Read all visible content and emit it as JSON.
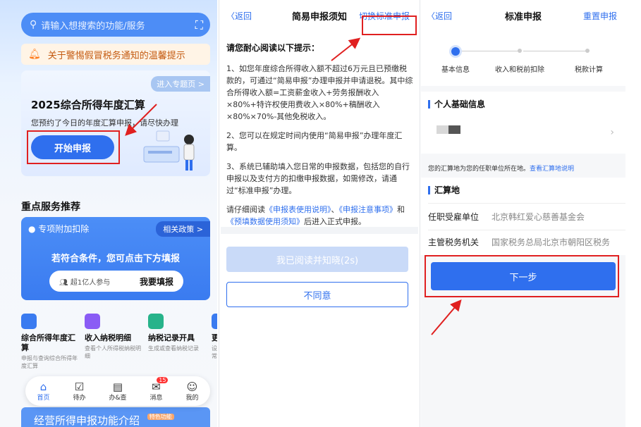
{
  "panel1": {
    "search_placeholder": "请输入想搜索的功能/服务",
    "notice": "关于警惕假冒税务通知的温馨提示",
    "hero": {
      "enter": "进入专题页 >",
      "title": "2025综合所得年度汇算",
      "subtitle": "您预约了今日的年度汇算申报，请尽快办理",
      "start_button": "开始申报"
    },
    "section_title": "重点服务推荐",
    "special": {
      "header": "专项附加扣除",
      "policy": "相关政策 >",
      "message": "若符合条件，您可点击下方填报",
      "participants": "超1亿人参与",
      "fill_button": "我要填报"
    },
    "services": [
      {
        "title": "综合所得年度汇算",
        "desc": "申报与查询综合所得年度汇算",
        "color": "#3a7bf0"
      },
      {
        "title": "收入纳税明细",
        "desc": "查看个人所得税纳税明细",
        "color": "#8a5cf5"
      },
      {
        "title": "纳税记录开具",
        "desc": "生成或查看纳税记录",
        "color": "#27b38a"
      },
      {
        "title": "更多I",
        "desc": "设置在常用功",
        "color": "#3a7bf0"
      }
    ],
    "tabs": [
      {
        "label": "首页",
        "icon": "home-icon"
      },
      {
        "label": "待办",
        "icon": "todo-icon"
      },
      {
        "label": "办&查",
        "icon": "query-icon"
      },
      {
        "label": "消息",
        "icon": "message-icon",
        "badge": "15"
      },
      {
        "label": "我的",
        "icon": "profile-icon"
      }
    ],
    "bottom_text": "经营所得申报功能介绍",
    "bottom_tag": "特色功能"
  },
  "panel2": {
    "back": "〈返回",
    "title": "简易申报须知",
    "switch": "切换标准申报",
    "heading": "请您耐心阅读以下提示：",
    "p1": "1、如您年度综合所得收入额不超过6万元且已预缴税款的，可通过“简易申报”办理申报并申请退税。其中综合所得收入额=工资薪金收入+劳务报酬收入×80%+特许权使用费收入×80%+稿酬收入×80%×70%-其他免税收入。",
    "p2": "2、您可以在规定时间内使用“简易申报”办理年度汇算。",
    "p3": "3、系统已辅助填入您日常的申报数据，包括您的自行申报以及支付方的扣缴申报数据，如需修改，请通过“标准申报”办理。",
    "p4_prefix": "请仔细阅读",
    "p4_link1": "《申报表使用说明》",
    "p4_sep": "、",
    "p4_link2": "《申报注意事项》",
    "p4_and": "和",
    "p4_link3": "《预填数据使用须知》",
    "p4_suffix": "后进入正式申报。",
    "read_button": "我已阅读并知晓(2s)",
    "disagree_button": "不同意"
  },
  "panel3": {
    "back": "〈返回",
    "title": "标准申报",
    "reset": "重置申报",
    "steps": [
      "基本信息",
      "收入和税前扣除",
      "税款计算"
    ],
    "personal_section": "个人基础信息",
    "note_text": "您的汇算地为您的任职单位所在地。",
    "note_link": "查看汇算地说明",
    "location_section": "汇算地",
    "employer_label": "任职受雇单位",
    "employer_value": "北京韩红爱心慈善基金会",
    "authority_label": "主管税务机关",
    "authority_value": "国家税务总局北京市朝阳区税务",
    "next_button": "下一步"
  }
}
